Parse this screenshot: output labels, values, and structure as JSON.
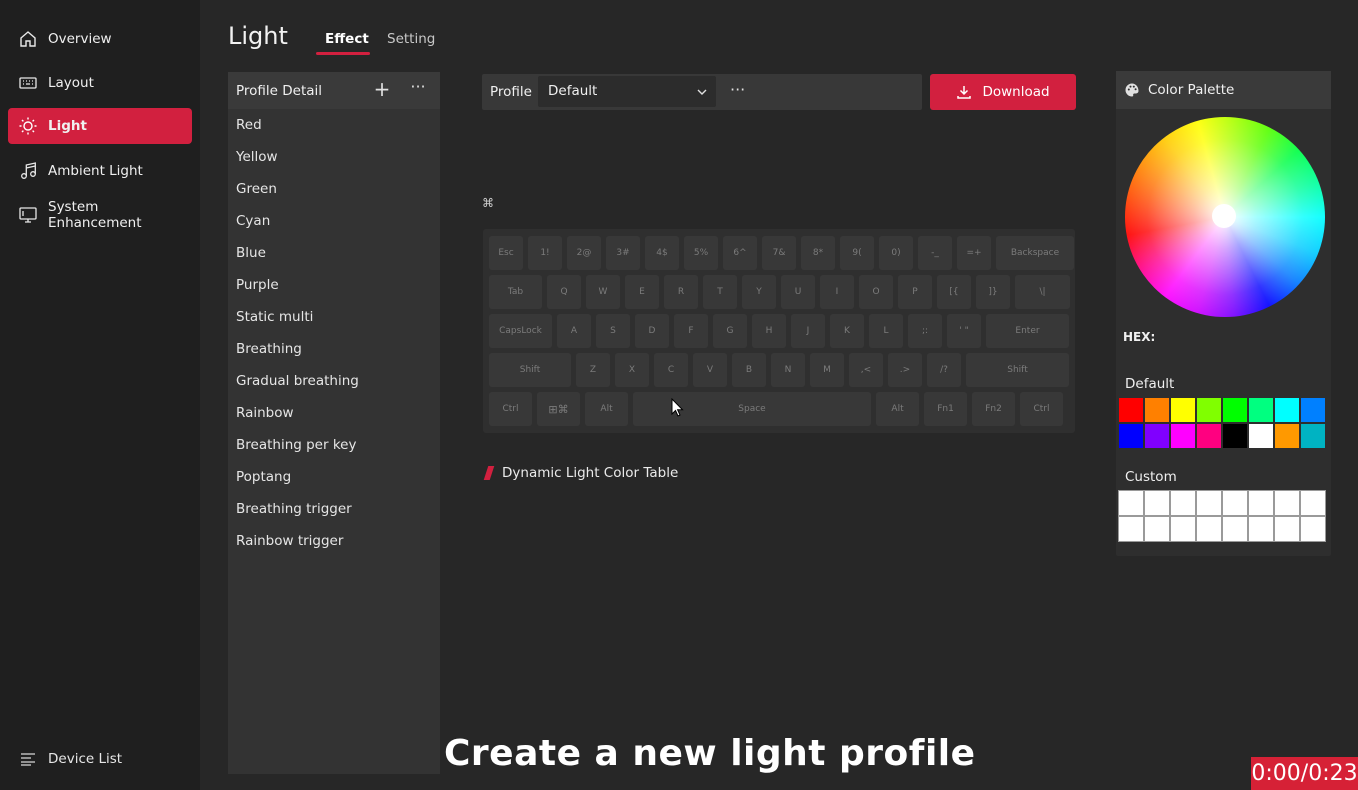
{
  "sidebar": {
    "items": [
      {
        "label": "Overview",
        "icon": "home-icon"
      },
      {
        "label": "Layout",
        "icon": "keyboard-icon"
      },
      {
        "label": "Light",
        "icon": "sun-icon",
        "active": true
      },
      {
        "label": "Ambient Light",
        "icon": "music-icon"
      },
      {
        "label": "System Enhancement",
        "icon": "monitor-icon"
      }
    ],
    "device_list": "Device List"
  },
  "header": {
    "title": "Light",
    "tabs": [
      {
        "label": "Effect",
        "active": true
      },
      {
        "label": "Setting"
      }
    ]
  },
  "profile_detail": {
    "title": "Profile Detail",
    "effects": [
      "Red",
      "Yellow",
      "Green",
      "Cyan",
      "Blue",
      "Purple",
      "Static multi",
      "Breathing",
      "Gradual breathing",
      "Rainbow",
      "Breathing per key",
      "Poptang",
      "Breathing trigger",
      "Rainbow trigger"
    ]
  },
  "profile_bar": {
    "label": "Profile",
    "selected": "Default",
    "download_label": "Download"
  },
  "keyboard": {
    "rows": [
      [
        "Esc",
        "1!",
        "2@",
        "3#",
        "4$",
        "5%",
        "6^",
        "7&",
        "8*",
        "9(",
        "0)",
        "-_",
        "=+",
        "Backspace"
      ],
      [
        "Tab",
        "Q",
        "W",
        "E",
        "R",
        "T",
        "Y",
        "U",
        "I",
        "O",
        "P",
        "[{",
        "]}",
        "\\|"
      ],
      [
        "CapsLock",
        "A",
        "S",
        "D",
        "F",
        "G",
        "H",
        "J",
        "K",
        "L",
        ";:",
        "' \"",
        "Enter"
      ],
      [
        "Shift",
        "Z",
        "X",
        "C",
        "V",
        "B",
        "N",
        "M",
        ",<",
        ".>",
        "/?",
        "Shift"
      ],
      [
        "Ctrl",
        "",
        "Alt",
        "Space",
        "Alt",
        "Fn1",
        "Fn2",
        "Ctrl"
      ]
    ]
  },
  "dynamic_table": "Dynamic Light Color Table",
  "palette": {
    "title": "Color Palette",
    "hex_label": "HEX:",
    "hex_value": "",
    "default_label": "Default",
    "default_colors": [
      "#ff0000",
      "#ff8000",
      "#ffff00",
      "#80ff00",
      "#00ff00",
      "#00ff80",
      "#00ffff",
      "#0080ff",
      "#0000ff",
      "#8000ff",
      "#ff00ff",
      "#ff0080",
      "#000000",
      "#ffffff",
      "#ff9900",
      "#00b3c2"
    ],
    "custom_label": "Custom",
    "custom_colors": [
      "#ffffff",
      "#ffffff",
      "#ffffff",
      "#ffffff",
      "#ffffff",
      "#ffffff",
      "#ffffff",
      "#ffffff",
      "#ffffff",
      "#ffffff",
      "#ffffff",
      "#ffffff",
      "#ffffff",
      "#ffffff",
      "#ffffff",
      "#ffffff"
    ]
  },
  "overlay": {
    "subtitle": "Create  a new light profile",
    "timer": "0:00/0:23"
  },
  "colors": {
    "accent": "#d2203f",
    "background": "#272727",
    "sidebar": "#1f1f1f"
  }
}
